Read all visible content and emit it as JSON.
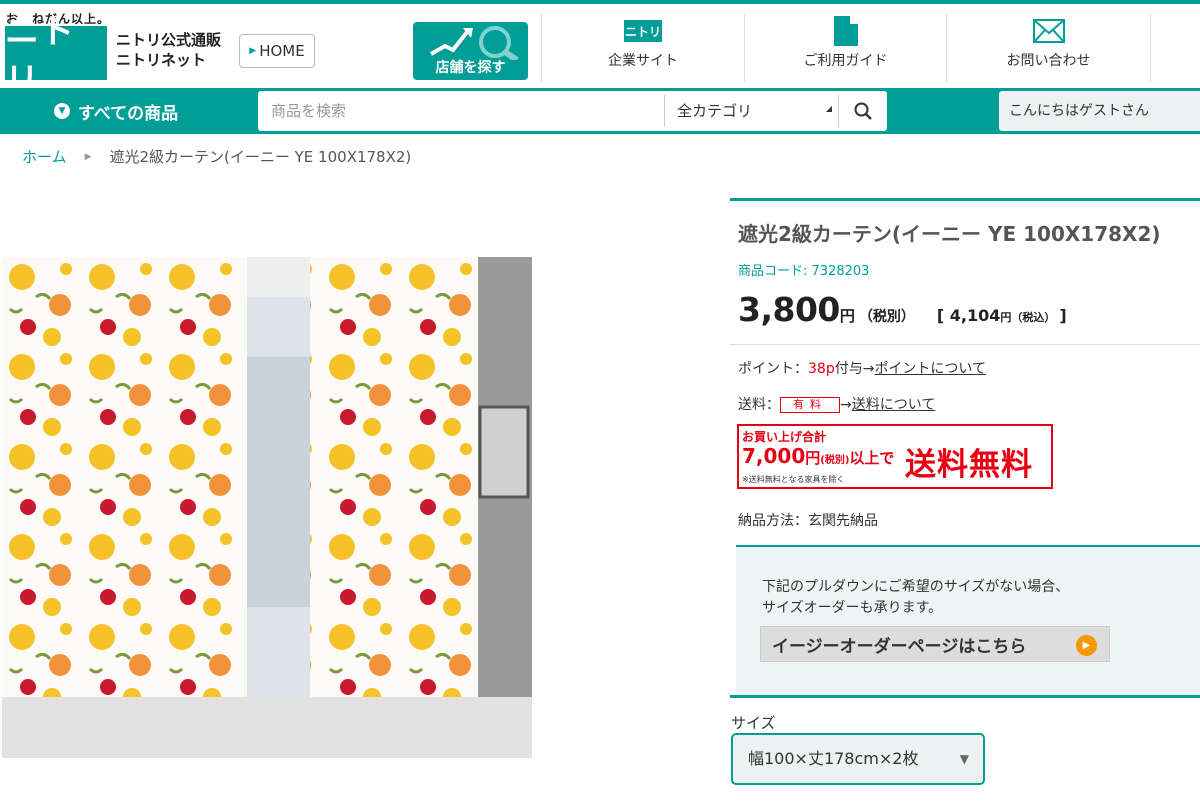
{
  "header": {
    "tagline": "お、ねだん以上。",
    "logo": "ニトリ",
    "brand_line1": "ニトリ公式通販",
    "brand_line2": "ニトリネット",
    "home_button": "HOME",
    "store_button": "店舗を探す",
    "nav": [
      {
        "label": "企業サイト",
        "icon": "nitori-logo-icon"
      },
      {
        "label": "ご利用ガイド",
        "icon": "document-icon"
      },
      {
        "label": "お問い合わせ",
        "icon": "envelope-icon"
      }
    ]
  },
  "navbar": {
    "all_products": "すべての商品",
    "search_placeholder": "商品を検索",
    "category": "全カテゴリ",
    "greeting": "こんにちはゲストさん"
  },
  "breadcrumb": {
    "home": "ホーム",
    "current": "遮光2級カーテン(イーニー YE 100X178X2)"
  },
  "product": {
    "title": "遮光2級カーテン(イーニー YE 100X178X2)",
    "code_label": "商品コード: 7328203",
    "price": "3,800",
    "price_unit": "円",
    "price_tax_note": "（税別）",
    "price_incl_open": "[ 4,104",
    "price_incl_unit": "円",
    "price_incl_note": "（税込）",
    "price_incl_close": "]",
    "points_label": "ポイント：",
    "points_value": "38p",
    "points_suffix": "付与→",
    "points_link": "ポイントについて",
    "shipping_label": "送料：",
    "shipping_badge": "有料",
    "shipping_arrow": "→",
    "shipping_link": "送料について",
    "banner_line1": "お買い上げ合計",
    "banner_amount": "7,000",
    "banner_yen": "円",
    "banner_tax": "(税別)",
    "banner_above": "以上で",
    "banner_free": "送料無料",
    "banner_note": "※送料無料となる家具を除く",
    "delivery": "納品方法：玄関先納品",
    "easy_text1": "下記のプルダウンにご希望のサイズがない場合、",
    "easy_text2": "サイズオーダーも承ります。",
    "easy_button": "イージーオーダーページはこちら",
    "size_label": "サイズ",
    "size_value": "幅100×丈178cm×2枚"
  },
  "colors": {
    "brand": "#009e96",
    "red": "#e60012",
    "orange": "#f39800"
  }
}
